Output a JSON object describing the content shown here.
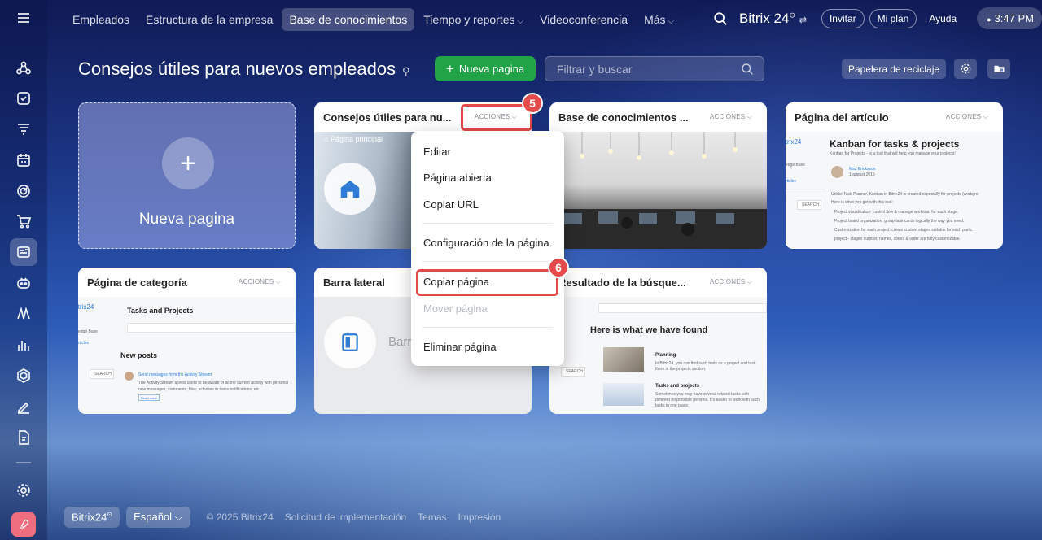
{
  "nav": {
    "tabs": [
      {
        "label": "Empleados",
        "active": false
      },
      {
        "label": "Estructura de la empresa",
        "active": false
      },
      {
        "label": "Base de conocimientos",
        "active": true
      },
      {
        "label": "Tiempo y reportes",
        "active": false,
        "dropdown": true
      },
      {
        "label": "Videoconferencia",
        "active": false
      },
      {
        "label": "Más",
        "active": false,
        "dropdown": true
      }
    ],
    "brand": "Bitrix 24",
    "invite": "Invitar",
    "plan": "Mi plan",
    "help": "Ayuda",
    "time": "3:47 PM"
  },
  "sidebar": {
    "icons": [
      "menu-icon",
      "collab-icon",
      "tasks-icon",
      "funnel-icon",
      "calendar-icon",
      "target-icon",
      "cart-icon",
      "knowledge-icon",
      "robot-icon",
      "marketing-icon",
      "analytics-icon",
      "hexagon-icon",
      "sign-icon",
      "document-icon",
      "settings-icon",
      "rocket-icon"
    ],
    "active": "knowledge-icon"
  },
  "page": {
    "title": "Consejos útiles para nuevos empleados",
    "new_button": "Nueva pagina",
    "filter_placeholder": "Filtrar y buscar",
    "trash_button": "Papelera de reciclaje"
  },
  "cards": {
    "new_label": "Nueva pagina",
    "actions": "ACCIONES",
    "c1": {
      "title": "Consejos útiles para nu...",
      "tag": "Página principal"
    },
    "c2": {
      "title": "Base de conocimientos ..."
    },
    "c3": {
      "title": "Página del artículo",
      "heading": "Kanban for tasks & projects",
      "sub": "Kanban for Projects - is a tool that will help you manage your projects!",
      "author": "Max Ericksson",
      "date": "1 august 2019",
      "logo": "itrix24",
      "nav1": "edge Base",
      "nav2": "rticles",
      "search": "SEARCH",
      "intro": "Unlike Task Planner, Kanban in Bitrix24 is created especially for projects (workgro",
      "intro2": "Here is what you get with this tool:",
      "b1": "Project visualization: control flow & manage workload for each stage.",
      "b2": "Project board organization: group task cards logically the way you need.",
      "b3": "Customization for each project: create custom stages suitable for each partic",
      "b4": "project - stages number, names, colors & order are fully customizable."
    },
    "c4": {
      "title": "Página de categoría",
      "logo": "itrix24",
      "heading": "Tasks and Projects",
      "nav1": "edge Base",
      "nav2": "rticles",
      "section": "New posts",
      "search": "SEARCH",
      "post": "Send messages from the Activity Stream",
      "post_text": "The Activity Stream allows users to be aware of all the current activity with personal",
      "post_text2": "new messages, comments, files, activities in tasks notifications, etc.",
      "read_more": "Read more"
    },
    "c5": {
      "title": "Barra lateral",
      "label": "Barr"
    },
    "c6": {
      "title": "Resultado de la búsque...",
      "heading": "Here is what we have found",
      "search": "SEARCH",
      "r1": "Planning",
      "r1_text": "In Bitrix24, you can find such tools as a project and task",
      "r1_text2": "them in the projects section.",
      "r2": "Tasks and projects",
      "r2_text": "Sometimes you may have several related tasks with",
      "r2_text2": "different responsible persons. It's easier to work with such",
      "r2_text3": "tasks in one place."
    }
  },
  "menu": {
    "items": [
      {
        "label": "Editar",
        "disabled": false
      },
      {
        "label": "Página abierta",
        "disabled": false
      },
      {
        "label": "Copiar URL",
        "disabled": false
      },
      {
        "label": "Configuración de la página",
        "disabled": false
      },
      {
        "label": "Copiar página",
        "disabled": false
      },
      {
        "label": "Mover página",
        "disabled": true
      },
      {
        "label": "Eliminar página",
        "disabled": false
      }
    ]
  },
  "annotations": {
    "step5": "5",
    "step6": "6",
    "color": "#e44a4a"
  },
  "footer": {
    "brand": "Bitrix24",
    "language": "Español",
    "copyright": "© 2025 Bitrix24",
    "links": [
      "Solicitud de implementación",
      "Temas",
      "Impresión"
    ]
  },
  "colors": {
    "accent_green": "#22a348",
    "annotation_red": "#e44a4a"
  }
}
